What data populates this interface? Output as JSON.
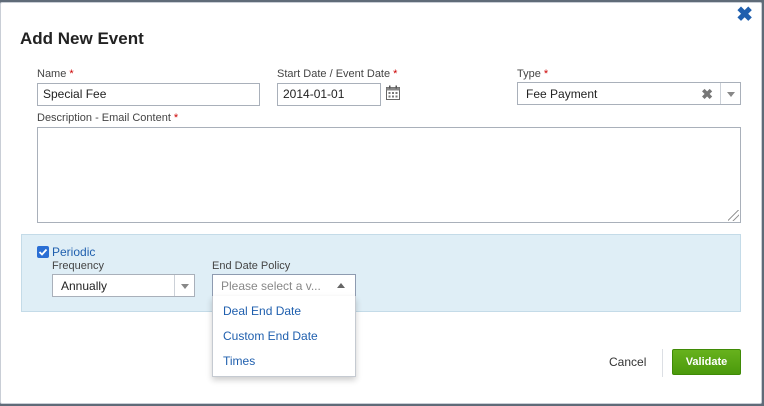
{
  "modal": {
    "title": "Add New Event",
    "close_glyph": "✖"
  },
  "fields": {
    "name": {
      "label": "Name",
      "value": "Special Fee"
    },
    "start_date": {
      "label": "Start Date / Event Date",
      "value": "2014-01-01"
    },
    "type": {
      "label": "Type",
      "value": "Fee Payment",
      "clear_glyph": "✖"
    },
    "description": {
      "label": "Description - Email Content",
      "value": ""
    },
    "required_mark": "*"
  },
  "periodic": {
    "label": "Periodic",
    "checked": true,
    "frequency": {
      "label": "Frequency",
      "value": "Annually"
    },
    "end_date_policy": {
      "label": "End Date Policy",
      "placeholder": "Please select a v...",
      "options": [
        "Deal End Date",
        "Custom End Date",
        "Times"
      ]
    }
  },
  "footer": {
    "cancel_label": "Cancel",
    "validate_label": "Validate"
  },
  "colors": {
    "accent": "#1f5fae",
    "validate_green": "#5aa716",
    "panel_bg": "#dfeef6"
  },
  "icons": [
    "close-icon",
    "calendar-icon",
    "clear-icon",
    "chevron-down-icon",
    "chevron-up-icon",
    "checkbox-checked-icon"
  ]
}
